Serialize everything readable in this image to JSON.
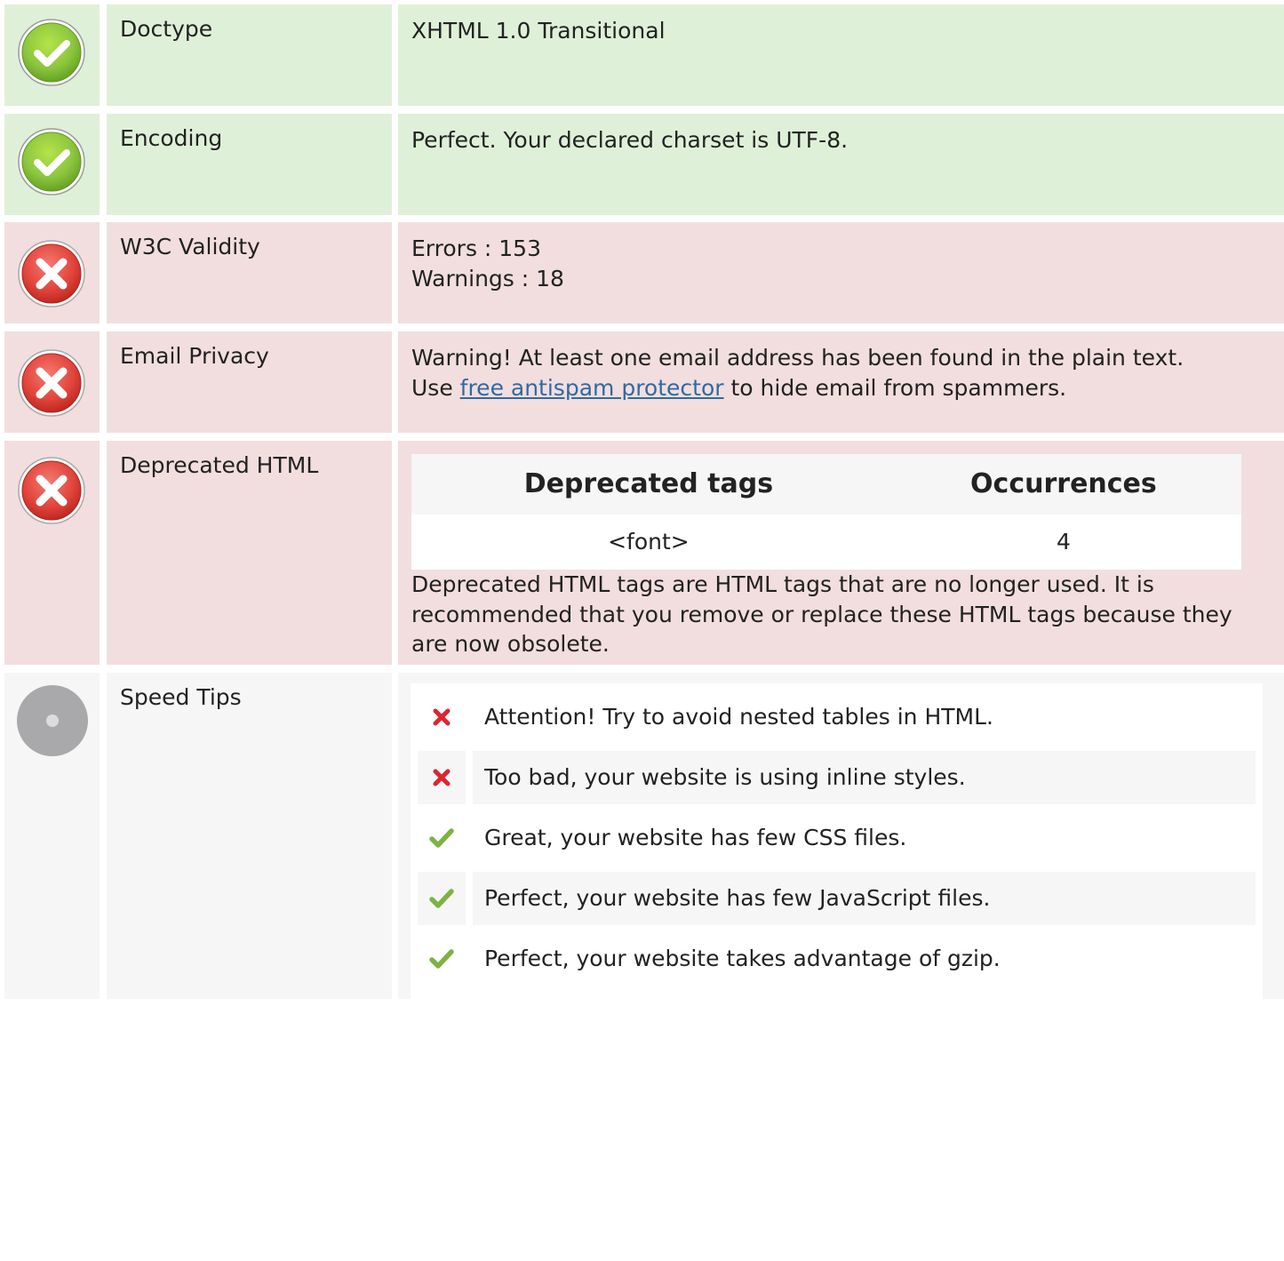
{
  "colors": {
    "ok_bg": "#dff0d8",
    "bad_bg": "#f2dede",
    "neutral_bg": "#f6f6f6",
    "link": "#2e6aa5",
    "cross": "#e0242e",
    "check": "#7cb342"
  },
  "rows": {
    "doctype": {
      "status_icon": "check-circle-icon",
      "label": "Doctype",
      "value": "XHTML 1.0 Transitional"
    },
    "encoding": {
      "status_icon": "check-circle-icon",
      "label": "Encoding",
      "value": "Perfect. Your declared charset is UTF-8."
    },
    "w3c": {
      "status_icon": "x-circle-icon",
      "label": "W3C Validity",
      "errors": "Errors : 153",
      "warnings": "Warnings : 18"
    },
    "email": {
      "status_icon": "x-circle-icon",
      "label": "Email Privacy",
      "line1": "Warning! At least one email address has been found in the plain text.",
      "line2_prefix": "Use ",
      "link_text": "free antispam protector",
      "line2_suffix": " to hide email from spammers."
    },
    "deprecated": {
      "status_icon": "x-circle-icon",
      "label": "Deprecated HTML",
      "table": {
        "headers": [
          "Deprecated tags",
          "Occurrences"
        ],
        "rows": [
          [
            "<font>",
            "4"
          ]
        ]
      },
      "note": "Deprecated HTML tags are HTML tags that are no longer used. It is recommended that you remove or replace these HTML tags because they are now obsolete."
    },
    "speed": {
      "status_icon": "neutral-circle-icon",
      "label": "Speed Tips",
      "tips": [
        {
          "icon": "cross-icon",
          "text": "Attention! Try to avoid nested tables in HTML."
        },
        {
          "icon": "cross-icon",
          "text": "Too bad, your website is using inline styles."
        },
        {
          "icon": "check-icon",
          "text": "Great, your website has few CSS files."
        },
        {
          "icon": "check-icon",
          "text": "Perfect, your website has few JavaScript files."
        },
        {
          "icon": "check-icon",
          "text": "Perfect, your website takes advantage of gzip."
        }
      ]
    }
  }
}
